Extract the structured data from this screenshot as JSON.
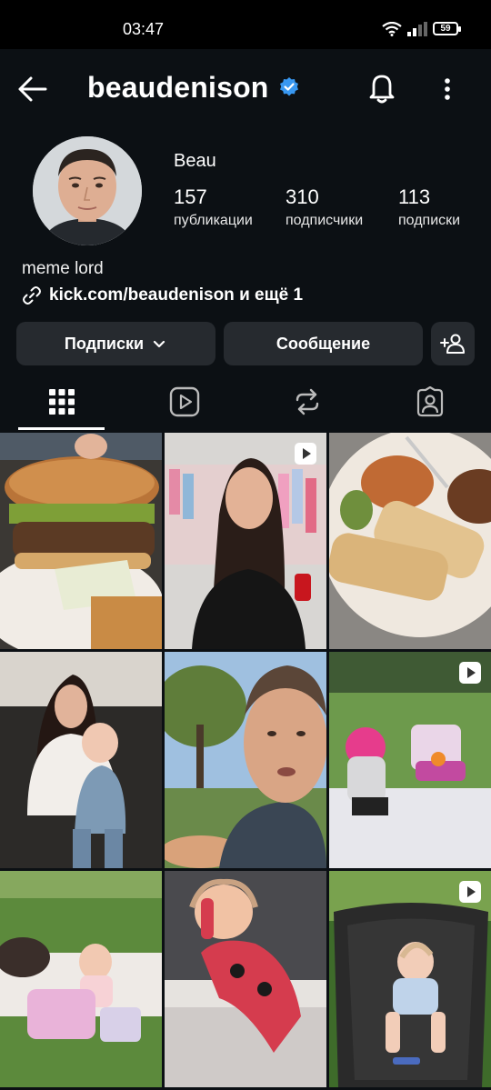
{
  "status_bar": {
    "time": "03:47",
    "battery": "59"
  },
  "header": {
    "username": "beaudenison"
  },
  "profile": {
    "name": "Beau",
    "stats": [
      {
        "value": "157",
        "label": "публикации"
      },
      {
        "value": "310",
        "label": "подписчики"
      },
      {
        "value": "113",
        "label": "подписки"
      }
    ],
    "bio": "meme lord",
    "link": "kick.com/beaudenison и ещё 1"
  },
  "actions": {
    "following_label": "Подписки",
    "message_label": "Сообщение"
  },
  "tabs": [
    "posts-grid",
    "reels",
    "reposts",
    "tagged"
  ],
  "grid": [
    {
      "subject": "burger",
      "reel": false
    },
    {
      "subject": "woman-in-store",
      "reel": true
    },
    {
      "subject": "tamales-plate",
      "reel": false
    },
    {
      "subject": "mother-and-baby",
      "reel": false
    },
    {
      "subject": "man-selfie",
      "reel": false
    },
    {
      "subject": "baby-on-blanket",
      "reel": true
    },
    {
      "subject": "baby-with-toy",
      "reel": false
    },
    {
      "subject": "baby-sleeping",
      "reel": false
    },
    {
      "subject": "baby-in-bin",
      "reel": true
    }
  ],
  "colors": {
    "background": "#0c1014",
    "button": "#262a2f",
    "verified": "#3897f0"
  }
}
